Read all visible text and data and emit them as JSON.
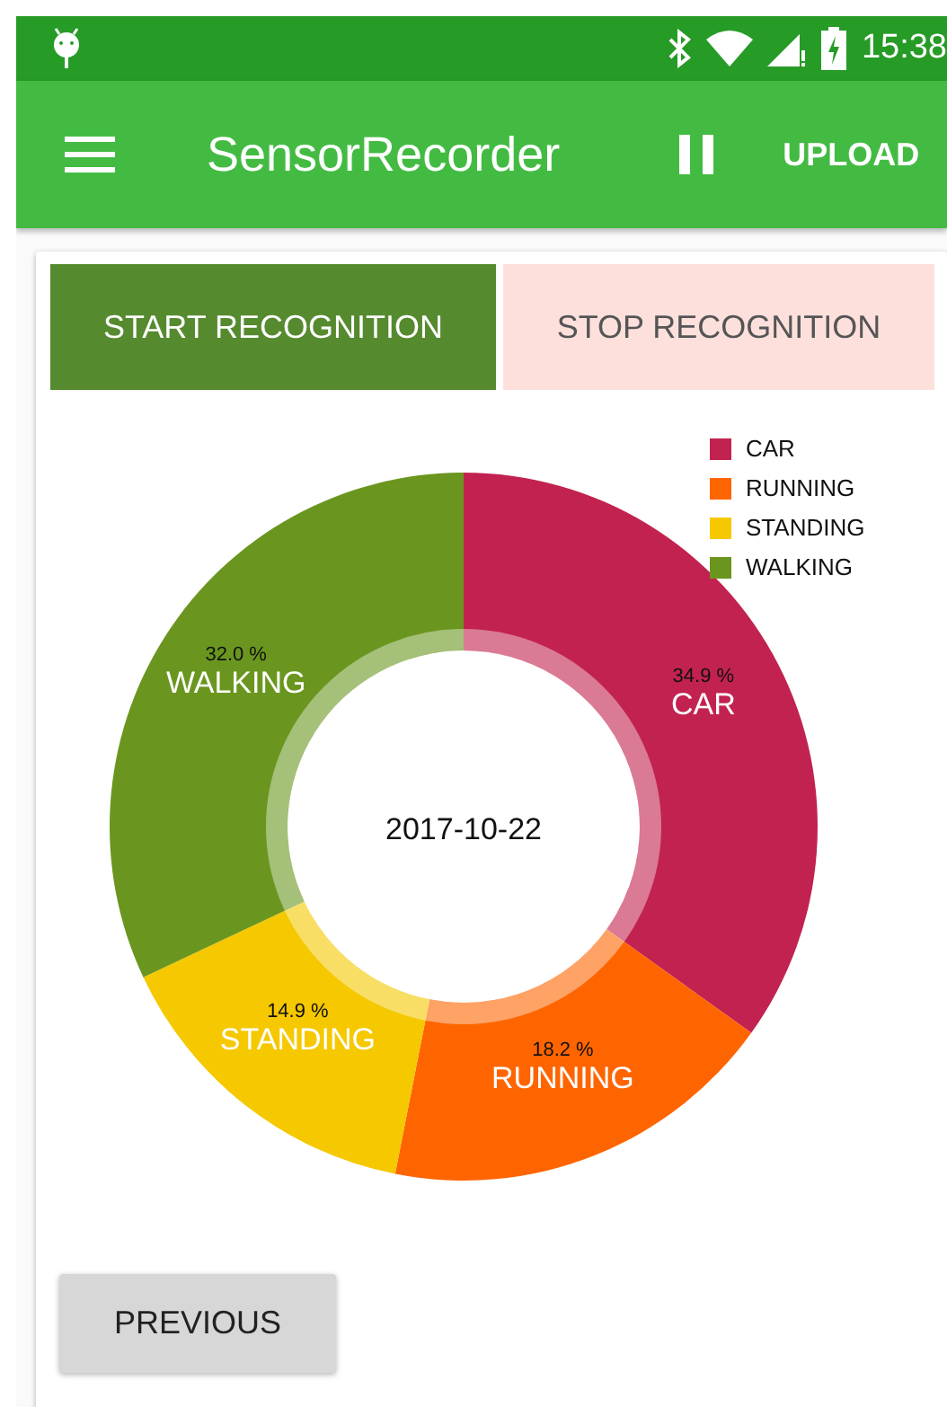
{
  "status_bar": {
    "time": "15:38"
  },
  "app_bar": {
    "title": "SensorRecorder",
    "action": "UPLOAD"
  },
  "buttons": [
    {
      "label": "START RECOGNITION",
      "kind": "primary"
    },
    {
      "label": "STOP RECOGNITION",
      "kind": "secondary"
    }
  ],
  "chart": {
    "center_label": "2017-10-22",
    "legend": [
      {
        "label": "CAR",
        "color": "#c2224f"
      },
      {
        "label": "RUNNING",
        "color": "#fe6500"
      },
      {
        "label": "STANDING",
        "color": "#f5c800"
      },
      {
        "label": "WALKING",
        "color": "#6a961f"
      }
    ],
    "chart_data": {
      "type": "donut",
      "categories": [
        "CAR",
        "RUNNING",
        "STANDING",
        "WALKING"
      ],
      "values": [
        34.9,
        18.2,
        14.9,
        32.0
      ],
      "value_labels": [
        "34.9 %",
        "18.2 %",
        "14.9 %",
        "32.0 %"
      ]
    }
  },
  "footer_button": {
    "label": "PREVIOUS"
  }
}
